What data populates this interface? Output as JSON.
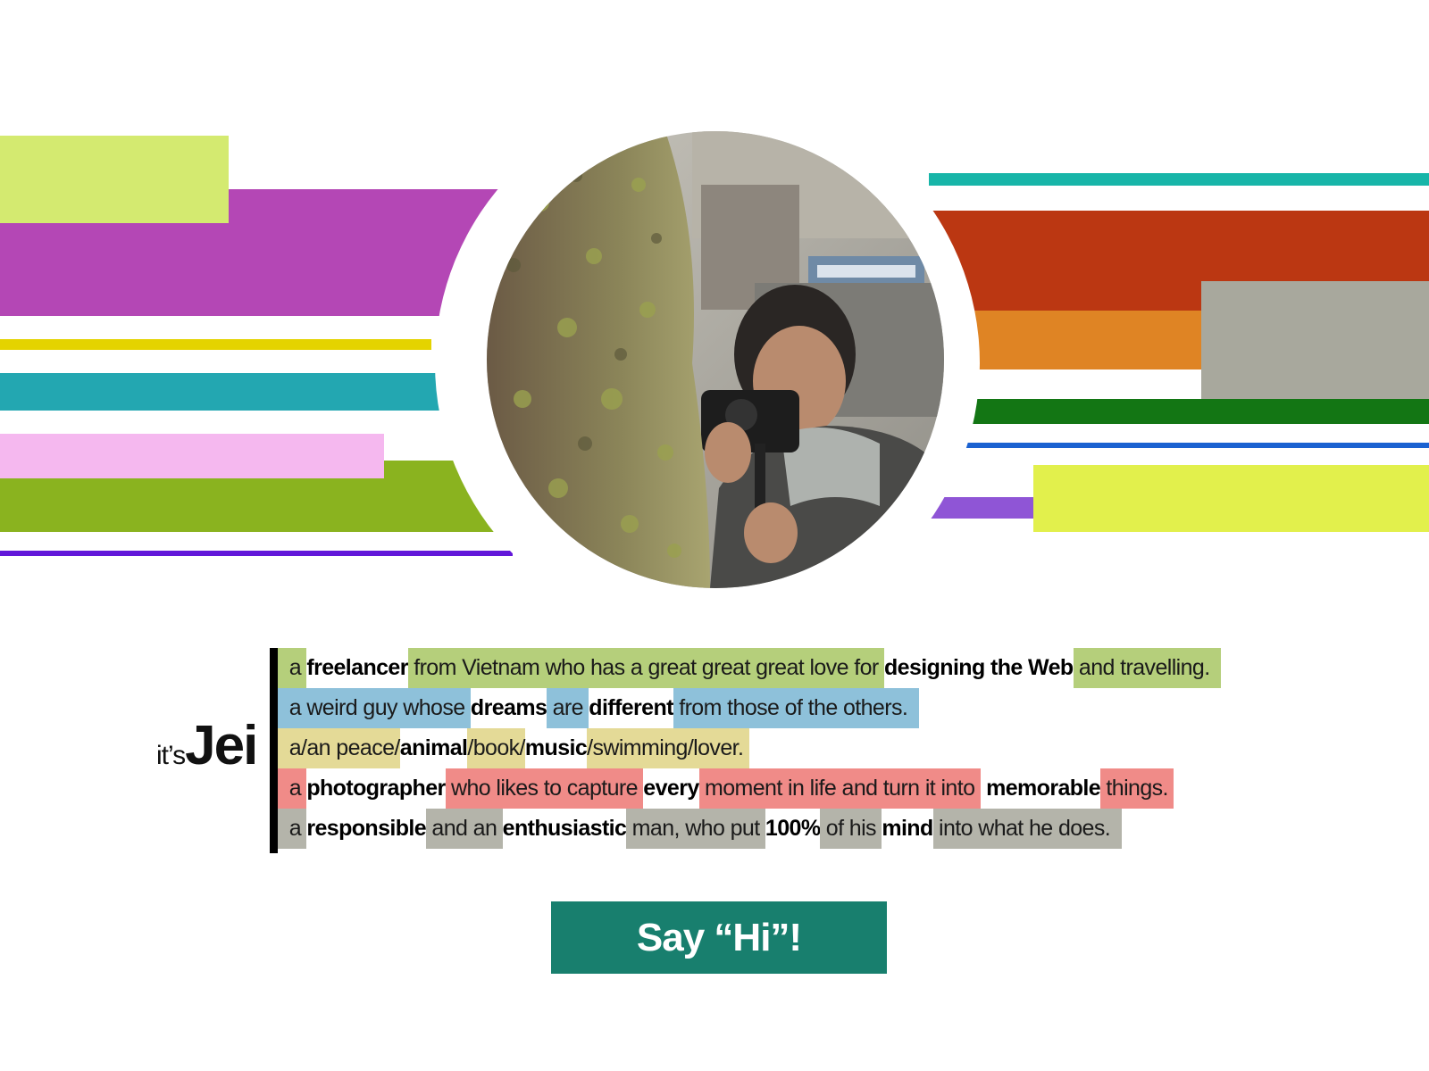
{
  "colors": {
    "left_stripes": [
      "#d4ea70",
      "#b447b5",
      "#e4d300",
      "#23a7b1",
      "#f5b8ef",
      "#8ab31f",
      "#6217d9"
    ],
    "right_stripes": [
      "#17b5a8",
      "#bb3712",
      "#df8424",
      "#a8a89d",
      "#137614",
      "#1b62d1",
      "#8f55d6",
      "#e2f04c"
    ],
    "highlight_green": "#b5cf7b",
    "highlight_blue": "#8ec1da",
    "highlight_yellow": "#e4da97",
    "highlight_red": "#f08b88",
    "highlight_gray": "#b4b4aa",
    "button_bg": "#187f6e"
  },
  "intro": {
    "prefix": "it’s",
    "name": "Jei"
  },
  "bio_lines": [
    {
      "color": "#b5cf7b",
      "segments": [
        {
          "text": "  a ",
          "bold": false,
          "hl": true
        },
        {
          "text": "freelancer",
          "bold": true,
          "hl": false
        },
        {
          "text": " from Vietnam who has a great great great love for ",
          "bold": false,
          "hl": true
        },
        {
          "text": "designing the Web",
          "bold": true,
          "hl": false
        },
        {
          "text": " and travelling.  ",
          "bold": false,
          "hl": true
        }
      ]
    },
    {
      "color": "#8ec1da",
      "segments": [
        {
          "text": "  a weird guy whose ",
          "bold": false,
          "hl": true
        },
        {
          "text": "dreams",
          "bold": true,
          "hl": false
        },
        {
          "text": " are ",
          "bold": false,
          "hl": true
        },
        {
          "text": "different",
          "bold": true,
          "hl": false
        },
        {
          "text": " from those of the others.  ",
          "bold": false,
          "hl": true
        }
      ]
    },
    {
      "color": "#e4da97",
      "segments": [
        {
          "text": "  a/an peace/",
          "bold": false,
          "hl": true
        },
        {
          "text": "animal",
          "bold": true,
          "hl": false
        },
        {
          "text": "/book/",
          "bold": false,
          "hl": true
        },
        {
          "text": "music",
          "bold": true,
          "hl": false
        },
        {
          "text": "/swimming/lover. ",
          "bold": false,
          "hl": true
        }
      ]
    },
    {
      "color": "#f08b88",
      "segments": [
        {
          "text": "  a ",
          "bold": false,
          "hl": true
        },
        {
          "text": "photographer",
          "bold": true,
          "hl": false
        },
        {
          "text": " who likes to capture ",
          "bold": false,
          "hl": true
        },
        {
          "text": "every",
          "bold": true,
          "hl": false
        },
        {
          "text": " moment in life and turn it into ",
          "bold": false,
          "hl": true
        },
        {
          "text": " memorable",
          "bold": true,
          "hl": false
        },
        {
          "text": " things. ",
          "bold": false,
          "hl": true
        }
      ]
    },
    {
      "color": "#b4b4aa",
      "segments": [
        {
          "text": "  a ",
          "bold": false,
          "hl": true
        },
        {
          "text": "responsible",
          "bold": true,
          "hl": false
        },
        {
          "text": " and an ",
          "bold": false,
          "hl": true
        },
        {
          "text": "enthusiastic",
          "bold": true,
          "hl": false
        },
        {
          "text": " man, who put ",
          "bold": false,
          "hl": true
        },
        {
          "text": "100%",
          "bold": true,
          "hl": false
        },
        {
          "text": " of his ",
          "bold": false,
          "hl": true
        },
        {
          "text": "mind",
          "bold": true,
          "hl": false
        },
        {
          "text": " into what he does.  ",
          "bold": false,
          "hl": true
        }
      ]
    }
  ],
  "cta": {
    "label": "Say “Hi”!"
  },
  "photo": {
    "description_icon": "profile-photo"
  }
}
